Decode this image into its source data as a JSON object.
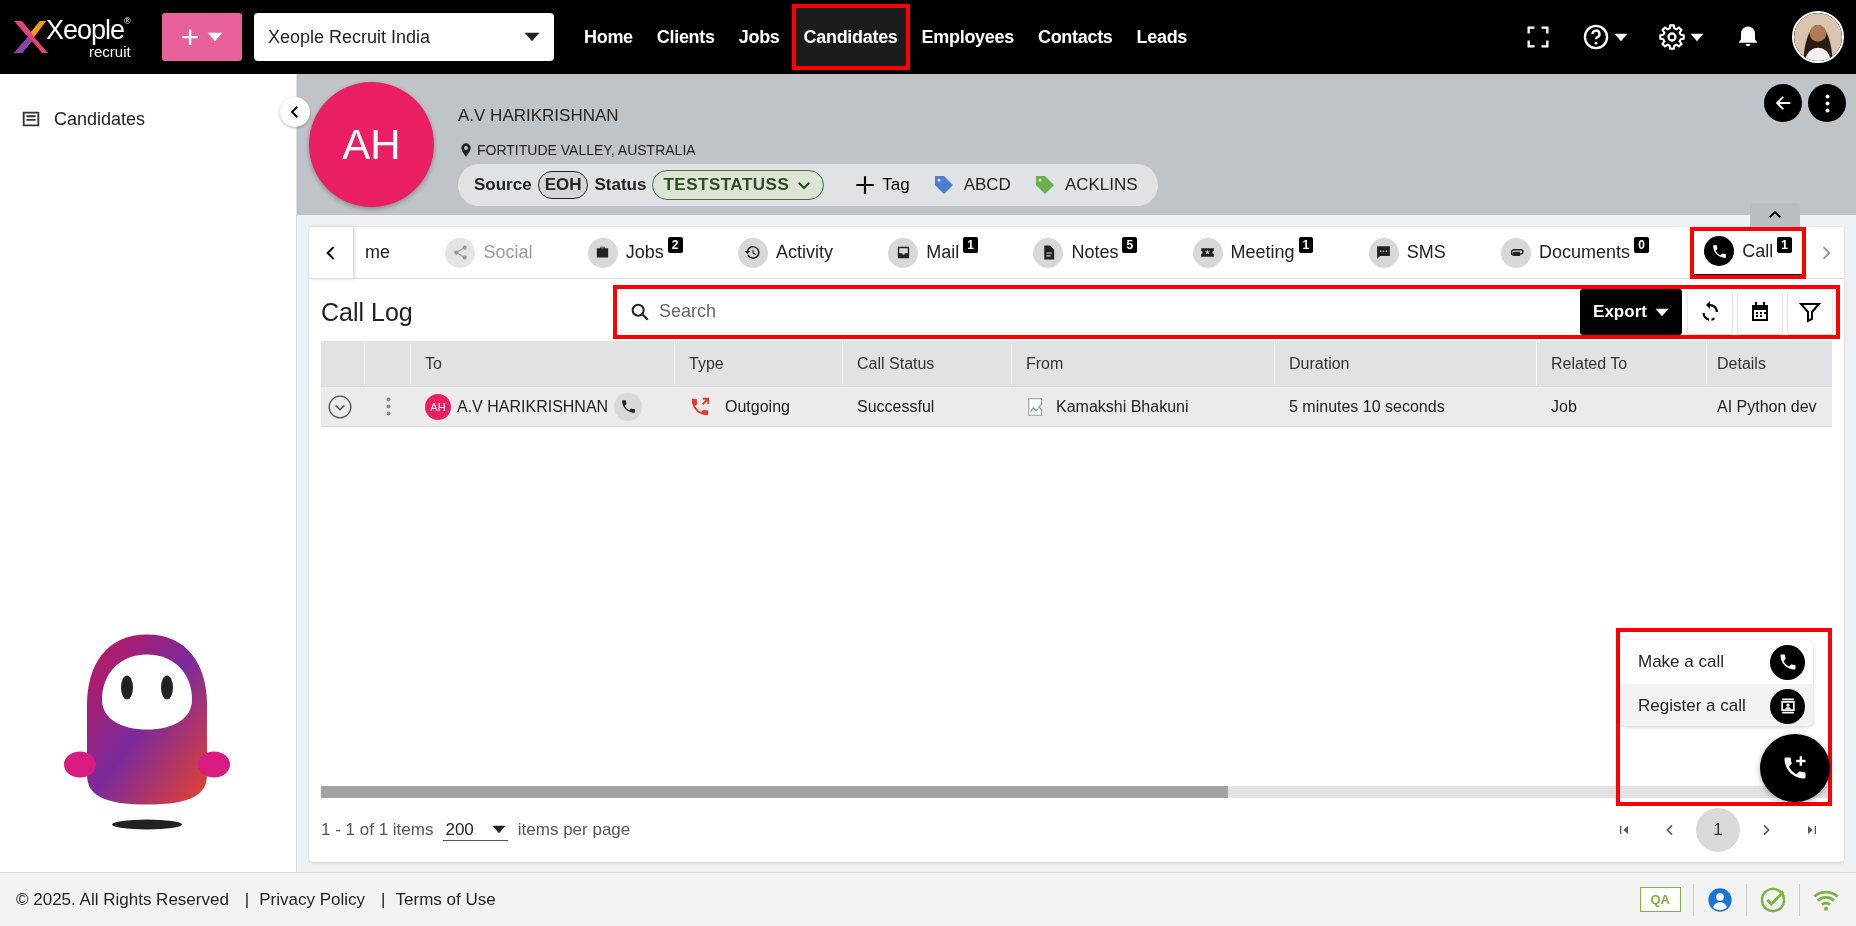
{
  "topbar": {
    "logo": {
      "brand": "Xeople",
      "sub": "recruit",
      "mark": "®"
    },
    "add_button": {
      "label": "+"
    },
    "org_select": {
      "value": "Xeople Recruit India"
    },
    "nav": [
      {
        "label": "Home",
        "selected": false,
        "highlighted": false
      },
      {
        "label": "Clients",
        "selected": false,
        "highlighted": false
      },
      {
        "label": "Jobs",
        "selected": false,
        "highlighted": false
      },
      {
        "label": "Candidates",
        "selected": true,
        "highlighted": true
      },
      {
        "label": "Employees",
        "selected": false,
        "highlighted": false
      },
      {
        "label": "Contacts",
        "selected": false,
        "highlighted": false
      },
      {
        "label": "Leads",
        "selected": false,
        "highlighted": false
      }
    ]
  },
  "sidebar": {
    "items": [
      {
        "label": "Candidates"
      }
    ]
  },
  "profile": {
    "initials": "AH",
    "name": "A.V HARIKRISHNAN",
    "location": "FORTITUDE VALLEY, AUSTRALIA",
    "source_label": "Source",
    "source": "EOH",
    "status_label": "Status",
    "status": "TESTSTATUSS",
    "tag_button": "Tag",
    "tags": [
      {
        "label": "ABCD",
        "color": "#4a7fd4"
      },
      {
        "label": "ACKLINS",
        "color": "#6ab04c"
      }
    ]
  },
  "tabs": [
    {
      "label": "me",
      "selected": false,
      "disabled": false
    },
    {
      "label": "Social",
      "selected": false,
      "disabled": true
    },
    {
      "label": "Jobs",
      "count": "2",
      "selected": false,
      "disabled": false
    },
    {
      "label": "Activity",
      "selected": false,
      "disabled": false
    },
    {
      "label": "Mail",
      "count": "1",
      "selected": false,
      "disabled": false
    },
    {
      "label": "Notes",
      "count": "5",
      "selected": false,
      "disabled": false
    },
    {
      "label": "Meeting",
      "count": "1",
      "selected": false,
      "disabled": false
    },
    {
      "label": "SMS",
      "selected": false,
      "disabled": false
    },
    {
      "label": "Documents",
      "count": "0",
      "selected": false,
      "disabled": false
    },
    {
      "label": "Call",
      "count": "1",
      "selected": true,
      "disabled": false,
      "highlighted": true
    }
  ],
  "call_log": {
    "title": "Call Log",
    "search": {
      "placeholder": "Search"
    },
    "export_button": "Export",
    "toolbar_highlighted": true,
    "table": {
      "columns": [
        "To",
        "Type",
        "Call Status",
        "From",
        "Duration",
        "Related To",
        "Details"
      ],
      "rows": [
        {
          "to_initials": "AH",
          "to": "A.V HARIKRISHNAN",
          "type": "Outgoing",
          "call_status": "Successful",
          "from": "Kamakshi Bhakuni",
          "duration": "5 minutes 10 seconds",
          "related_to": "Job",
          "details": "AI Python dev"
        }
      ]
    },
    "pagination": {
      "summary": "1 - 1 of 1 items",
      "page_size": "200",
      "page_size_label": "items per page",
      "current_page": "1"
    }
  },
  "fab_menu": {
    "highlighted": true,
    "items": [
      {
        "label": "Make a call",
        "selected": false
      },
      {
        "label": "Register a call",
        "selected": true
      }
    ]
  },
  "footer": {
    "copyright": "© 2025. All Rights Reserved",
    "separator_1": "|",
    "privacy": "Privacy Policy",
    "separator_2": "|",
    "terms": "Terms of Use",
    "env_badge": "QA"
  }
}
